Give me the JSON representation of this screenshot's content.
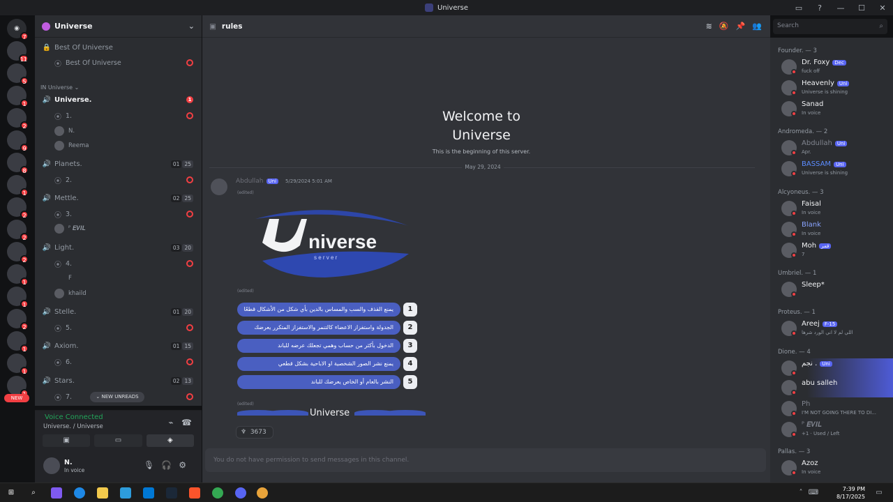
{
  "window": {
    "title": "Universe",
    "controls": [
      "▭",
      "?",
      "—",
      "☐",
      "✕"
    ]
  },
  "servers": {
    "badges": [
      "7",
      "11",
      "5",
      "1",
      "2",
      "9",
      "8",
      "1",
      "2",
      "2",
      "2",
      "1",
      "1",
      "2",
      "1",
      "1",
      "1",
      "5"
    ],
    "new_label": "NEW"
  },
  "sidebar": {
    "server_name": "Universe",
    "channels": [
      {
        "name": "Best Of Universe"
      },
      {
        "name": "Best Of Universe"
      },
      {
        "category": "IN Universe"
      },
      {
        "name": "Universe.",
        "unread": "1"
      },
      {
        "name": "1."
      },
      {
        "user": "N."
      },
      {
        "user": "Reema"
      },
      {
        "name": "Planets.",
        "c1": "01",
        "c2": "25"
      },
      {
        "name": "2."
      },
      {
        "name": "Mettle.",
        "c1": "02",
        "c2": "25"
      },
      {
        "name": "3."
      },
      {
        "user": "ᴾ 𝑬𝑽𝑰𝑳"
      },
      {
        "name": "Light.",
        "c1": "03",
        "c2": "20"
      },
      {
        "name": "4."
      },
      {
        "user": "F"
      },
      {
        "user": "khaild"
      },
      {
        "name": "Stelle.",
        "c1": "01",
        "c2": "20"
      },
      {
        "name": "5."
      },
      {
        "name": "Axiom.",
        "c1": "01",
        "c2": "15"
      },
      {
        "name": "6."
      },
      {
        "name": "Stars.",
        "c1": "02",
        "c2": "13"
      },
      {
        "name": "7."
      }
    ],
    "new_unreads": "⌄ NEW UNREADS"
  },
  "voice": {
    "title": "Voice Connected",
    "sub": "Universe. / Universe"
  },
  "user": {
    "name": "N.",
    "status": "In voice"
  },
  "channel": {
    "name": "rules",
    "search_placeholder": "Search"
  },
  "welcome": {
    "line1": "Welcome to",
    "line2": "Universe",
    "sub": "This is the beginning of this server.",
    "date": "May 29, 2024"
  },
  "message": {
    "author": "Abdullah",
    "tag": "Uni",
    "time": "5/29/2024 5:01 AM",
    "edited": "(edited)",
    "logo_text": "niverse",
    "logo_sub": "s e r v e r",
    "rules": [
      "يمنع القذف والسب والمساس بالدين بأي شكل من الأشكال قطعًا",
      "الجدولة واستفزاز الاعضاء كالتنمر والاستفزاز المتكرر يعرضك للسجن",
      "الدخول بأكثر من حساب وهمي تجعلك عرضه للباند",
      "يمنع نشر الصور الشخصية او الاباحية بشكل قطعي",
      "النشر بالعام أو الخاص يعرضك للباند"
    ],
    "rule_numbers": [
      "1",
      "2",
      "3",
      "4",
      "5"
    ],
    "banner_text": "niverse",
    "reaction_count": "3673"
  },
  "chatbox": {
    "placeholder": "You do not have permission to send messages in this channel."
  },
  "members": [
    {
      "group": "Founder. — 3"
    },
    {
      "name": "Dr. Foxy",
      "tag": "Dec",
      "status": "fuck off"
    },
    {
      "name": "Heavenly",
      "tag": "Uni",
      "status": "Universe is shining"
    },
    {
      "name": "Sanad",
      "status": "In voice"
    },
    {
      "group": "Andromeda. — 2"
    },
    {
      "name": "Abdullah",
      "tag": "Uni",
      "status": "Apr."
    },
    {
      "name": "BASSAM",
      "tag": "Uni",
      "status": "Universe is shining"
    },
    {
      "group": "Alcyoneus. — 3"
    },
    {
      "name": "Faisal",
      "status": "In voice"
    },
    {
      "name": "Blank",
      "status": "In voice"
    },
    {
      "name": "Moh",
      "tag": "قمر",
      "status": "7"
    },
    {
      "group": "Umbriel. — 1"
    },
    {
      "name": "Sleep*",
      "status": ""
    },
    {
      "group": "Proteus. — 1"
    },
    {
      "name": "Areej",
      "tag": "F-15",
      "status": "اللي لم لا اني الورد شرها"
    },
    {
      "group": "Dione. — 4"
    },
    {
      "name": "نجم .",
      "tag": "Uni",
      "status": ""
    },
    {
      "name": "abu salleh",
      "status": ""
    },
    {
      "name": "Ph",
      "status": "I'M NOT GOING THERE TO DI..."
    },
    {
      "name": "ᴾ 𝑬𝑽𝑰𝑳",
      "status": "+1 · Used / Left"
    },
    {
      "group": "Pallas. — 3"
    },
    {
      "name": "Azoz",
      "status": "In voice"
    }
  ],
  "taskbar": {
    "time": "7:39 PM",
    "date": "8/17/2025"
  },
  "colors": {
    "accent": "#5865f2",
    "online": "#23a55a",
    "dnd": "#f23f43",
    "bg": "#313338"
  }
}
